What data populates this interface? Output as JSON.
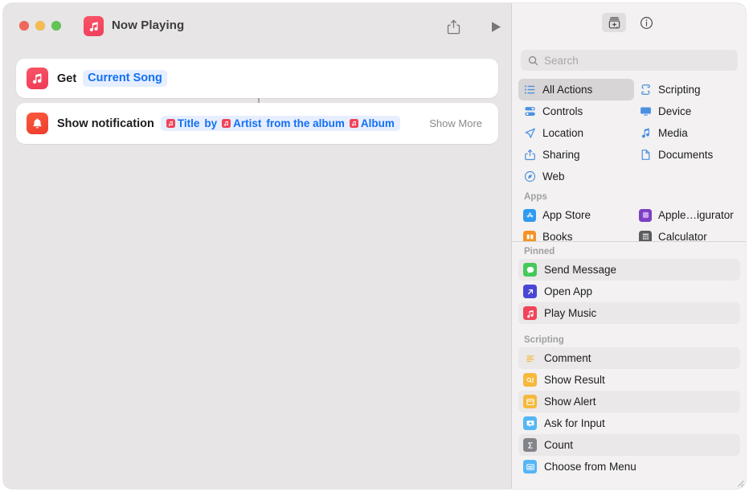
{
  "window": {
    "title": "Now Playing",
    "doc_icon": "music-note-icon",
    "traffic": {
      "close": "close-button",
      "minimize": "minimize-button",
      "zoom": "zoom-button"
    },
    "toolbar": {
      "share_icon": "share-icon",
      "play_icon": "play-icon"
    }
  },
  "workflow": {
    "actions": [
      {
        "icon": "music-app-icon",
        "label": "Get",
        "token": "Current Song"
      },
      {
        "icon": "notification-bell-icon",
        "label": "Show notification",
        "tokens": [
          {
            "type": "var",
            "text": "Title",
            "icon": "music-variable-icon"
          },
          {
            "type": "text",
            "text": "by"
          },
          {
            "type": "var",
            "text": "Artist",
            "icon": "music-variable-icon"
          },
          {
            "type": "text",
            "text": "from the album"
          },
          {
            "type": "var",
            "text": "Album",
            "icon": "music-variable-icon"
          }
        ],
        "show_more": "Show More"
      }
    ]
  },
  "sidebar": {
    "toolbar": [
      {
        "name": "action-library-button",
        "icon": "library-add-icon",
        "selected": true
      },
      {
        "name": "info-button",
        "icon": "info-circle-icon",
        "selected": false
      }
    ],
    "search": {
      "placeholder": "Search",
      "value": "",
      "icon": "search-icon"
    },
    "categories": [
      {
        "label": "All Actions",
        "icon": "list-bullet-icon",
        "color": "#4a90e2",
        "selected": true
      },
      {
        "label": "Scripting",
        "icon": "scroll-icon",
        "color": "#4a90e2",
        "selected": false
      },
      {
        "label": "Controls",
        "icon": "sliders-icon",
        "color": "#4a90e2",
        "selected": false
      },
      {
        "label": "Device",
        "icon": "display-icon",
        "color": "#4a90e2",
        "selected": false
      },
      {
        "label": "Location",
        "icon": "paper-plane-icon",
        "color": "#4a90e2",
        "selected": false
      },
      {
        "label": "Media",
        "icon": "music-note-icon",
        "color": "#4a90e2",
        "selected": false
      },
      {
        "label": "Sharing",
        "icon": "share-icon",
        "color": "#4a90e2",
        "selected": false
      },
      {
        "label": "Documents",
        "icon": "document-icon",
        "color": "#4a90e2",
        "selected": false
      },
      {
        "label": "Web",
        "icon": "compass-icon",
        "color": "#4a90e2",
        "selected": false
      }
    ],
    "apps_header": "Apps",
    "apps": [
      {
        "label": "App Store",
        "icon": "app-store-icon",
        "color": "#2f9bf2"
      },
      {
        "label": "Apple…igurator",
        "icon": "apple-configurator-icon",
        "color": "#7d3fc4"
      },
      {
        "label": "Books",
        "icon": "books-icon",
        "color": "#f59224"
      },
      {
        "label": "Calculator",
        "icon": "calculator-icon",
        "color": "#5c5c5e"
      }
    ],
    "pinned_header": "Pinned",
    "pinned": [
      {
        "label": "Send Message",
        "icon": "messages-icon",
        "color": "#45c85a"
      },
      {
        "label": "Open App",
        "icon": "open-app-icon",
        "color": "#4a47d4"
      },
      {
        "label": "Play Music",
        "icon": "music-app-icon",
        "color": "#f0445a"
      }
    ],
    "scripting_header": "Scripting",
    "scripting": [
      {
        "label": "Comment",
        "icon": "comment-lines-icon",
        "color": "#f5b93c"
      },
      {
        "label": "Show Result",
        "icon": "show-result-icon",
        "color": "#f5b93c"
      },
      {
        "label": "Show Alert",
        "icon": "alert-window-icon",
        "color": "#f5b93c"
      },
      {
        "label": "Ask for Input",
        "icon": "ask-input-icon",
        "color": "#54b6f5"
      },
      {
        "label": "Count",
        "icon": "sigma-count-icon",
        "color": "#83838a"
      },
      {
        "label": "Choose from Menu",
        "icon": "menu-choose-icon",
        "color": "#54b6f5"
      }
    ]
  }
}
